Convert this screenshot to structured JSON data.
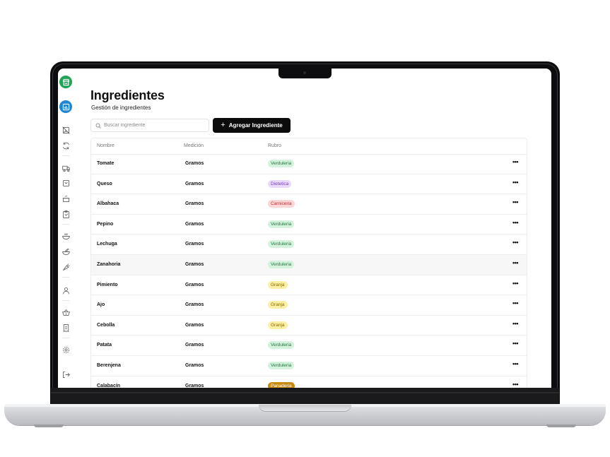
{
  "page": {
    "title": "Ingredientes",
    "subtitle": "Gestión de ingredientes"
  },
  "search": {
    "placeholder": "Buscar ingrediente"
  },
  "add_button": {
    "label": "Agregar Ingrediente",
    "icon": "plus-icon"
  },
  "sidebar": {
    "items": [
      {
        "icon": "store-icon",
        "active_color": "#22a35a"
      },
      {
        "icon": "bar-chart-icon",
        "active_color": "#1f86d6"
      },
      {
        "icon": "no-image-icon"
      },
      {
        "icon": "refresh-icon"
      },
      {
        "icon": "truck-icon"
      },
      {
        "icon": "shopping-bag-icon"
      },
      {
        "icon": "pot-icon"
      },
      {
        "icon": "clipboard-icon"
      },
      {
        "icon": "soup-bowl-icon"
      },
      {
        "icon": "salad-icon"
      },
      {
        "icon": "carrot-icon"
      },
      {
        "icon": "user-icon"
      },
      {
        "icon": "basket-icon"
      },
      {
        "icon": "receipt-icon"
      },
      {
        "icon": "settings-icon"
      },
      {
        "icon": "logout-icon"
      }
    ]
  },
  "table": {
    "columns": [
      "Nombre",
      "Medición",
      "Rubro"
    ],
    "rows": [
      {
        "name": "Tomate",
        "unit": "Gramos",
        "category": "Verduleria"
      },
      {
        "name": "Queso",
        "unit": "Gramos",
        "category": "Dietetica"
      },
      {
        "name": "Albahaca",
        "unit": "Gramos",
        "category": "Carniceria"
      },
      {
        "name": "Pepino",
        "unit": "Gramos",
        "category": "Verduleria"
      },
      {
        "name": "Lechuga",
        "unit": "Gramos",
        "category": "Verduleria"
      },
      {
        "name": "Zanahoria",
        "unit": "Gramos",
        "category": "Verduleria"
      },
      {
        "name": "Pimiento",
        "unit": "Gramos",
        "category": "Granja"
      },
      {
        "name": "Ajo",
        "unit": "Gramos",
        "category": "Granja"
      },
      {
        "name": "Cebolla",
        "unit": "Gramos",
        "category": "Granja"
      },
      {
        "name": "Patata",
        "unit": "Gramos",
        "category": "Verduleria"
      },
      {
        "name": "Berenjena",
        "unit": "Gramos",
        "category": "Verduleria"
      },
      {
        "name": "Calabacín",
        "unit": "Gramos",
        "category": "Panaderia"
      }
    ],
    "row_action": "more-options-icon"
  },
  "category_colors": {
    "Verduleria": {
      "bg": "#d3f3dc",
      "fg": "#1f7a3f"
    },
    "Dietetica": {
      "bg": "#ead9fb",
      "fg": "#7a3fc0"
    },
    "Carniceria": {
      "bg": "#fbd6d6",
      "fg": "#b83232"
    },
    "Granja": {
      "bg": "#fcefa6",
      "fg": "#8a6a00"
    },
    "Panaderia": {
      "bg": "#c78a12",
      "fg": "#ffffff"
    }
  }
}
